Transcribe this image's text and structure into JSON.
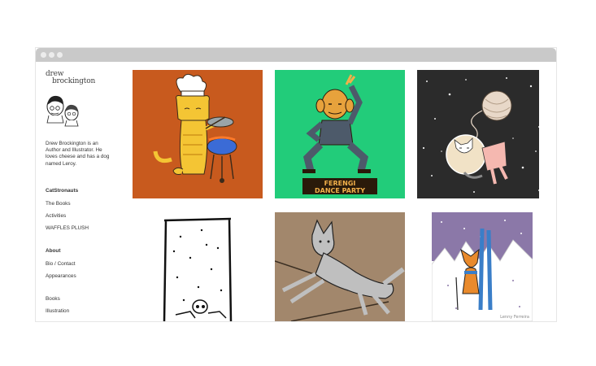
{
  "site": {
    "logo_line1": "drew",
    "logo_line2": "brockington",
    "bio": "Drew Brockington is an Author and Illustrator. He loves cheese and has a dog named Leroy."
  },
  "nav": {
    "group1": [
      {
        "label": "CatStronauts",
        "bold": true
      },
      {
        "label": "The Books"
      },
      {
        "label": "Activities"
      },
      {
        "label": "WAFFLES PLUSH"
      }
    ],
    "group2": [
      {
        "label": "About",
        "bold": true
      },
      {
        "label": "Bio / Contact"
      },
      {
        "label": "Appearances"
      }
    ],
    "group3": [
      {
        "label": "Books"
      },
      {
        "label": "Illustration"
      }
    ]
  },
  "gallery": {
    "tiles": [
      {
        "subject": "cat-chef-grilling",
        "bg": "#c85a1e"
      },
      {
        "subject": "dance-party-poster",
        "bg": "#22cc7a",
        "poster_line1": "FERENGI",
        "poster_line2": "DANCE PARTY"
      },
      {
        "subject": "catstronaut-yarn-space",
        "bg": "#2b2b2b"
      },
      {
        "subject": "skeleton-snow-sketch",
        "bg": "#ffffff"
      },
      {
        "subject": "leaping-wolf",
        "bg": "#a2876c"
      },
      {
        "subject": "fox-skier-mountains",
        "bg": "#ffffff",
        "signature": "Lenny Ferreira"
      }
    ]
  }
}
